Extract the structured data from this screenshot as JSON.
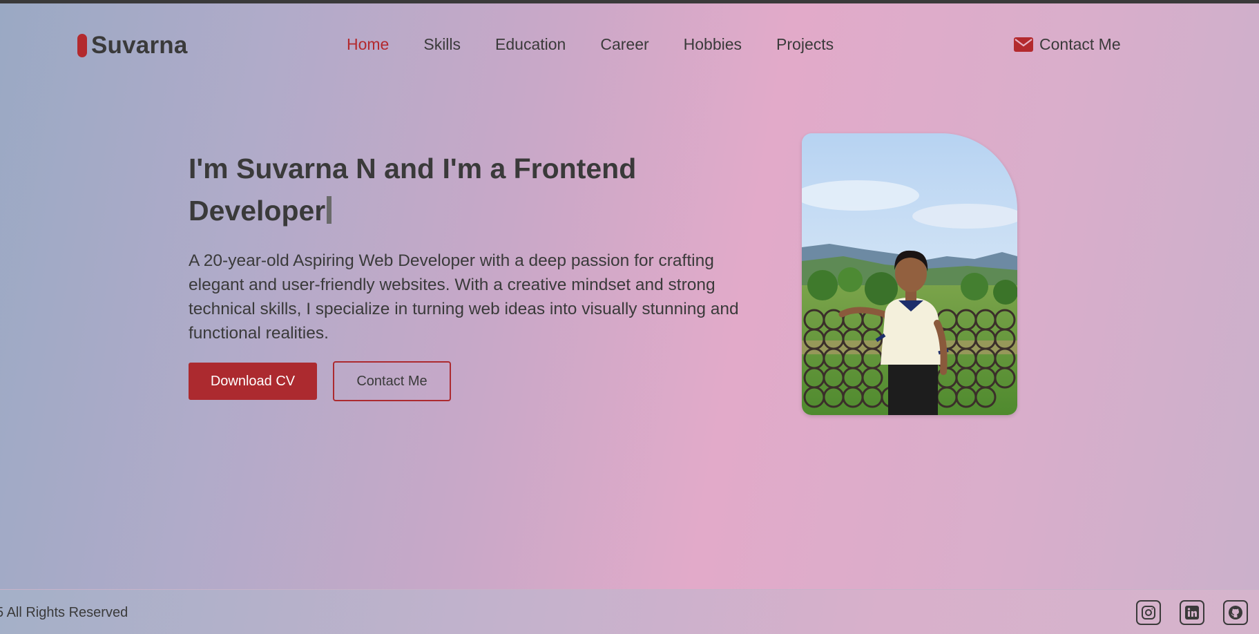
{
  "brand": {
    "name": "Suvarna",
    "accent": "#b32a2e"
  },
  "nav": {
    "items": [
      {
        "label": "Home",
        "active": true
      },
      {
        "label": "Skills",
        "active": false
      },
      {
        "label": "Education",
        "active": false
      },
      {
        "label": "Career",
        "active": false
      },
      {
        "label": "Hobbies",
        "active": false
      },
      {
        "label": "Projects",
        "active": false
      }
    ],
    "contact_label": "Contact Me",
    "contact_icon": "envelope-icon"
  },
  "hero": {
    "headline": "I'm Suvarna N and I'm a Frontend Developer",
    "intro": "A 20-year-old Aspiring Web Developer with a deep passion for crafting elegant and user-friendly websites. With a creative mindset and strong technical skills, I specialize in turning web ideas into visually stunning and functional realities.",
    "download_label": "Download CV",
    "contact_label": "Contact Me"
  },
  "footer": {
    "copyright": "5 All Rights Reserved",
    "social_icons": [
      "instagram-icon",
      "linkedin-icon",
      "github-icon"
    ]
  }
}
